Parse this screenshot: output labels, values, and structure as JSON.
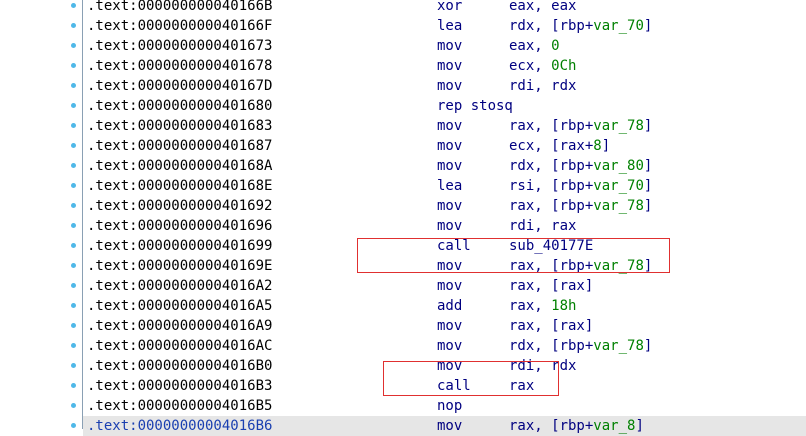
{
  "colors": {
    "background": "#ffffff",
    "address": "#000000",
    "instruction": "#000080",
    "variable": "#008000",
    "gutter_dot": "#4fb8e8",
    "annotation_box": "#e03030",
    "current_row": "#e6e6e6"
  },
  "listing": [
    {
      "addr": ".text:000000000040166B",
      "mnem": "xor",
      "ops": [
        {
          "t": "eax, eax",
          "c": "k"
        }
      ]
    },
    {
      "addr": ".text:000000000040166F",
      "mnem": "lea",
      "ops": [
        {
          "t": "rdx, [rbp+",
          "c": "k"
        },
        {
          "t": "var_70",
          "c": "v"
        },
        {
          "t": "]",
          "c": "k"
        }
      ]
    },
    {
      "addr": ".text:0000000000401673",
      "mnem": "mov",
      "ops": [
        {
          "t": "eax, ",
          "c": "k"
        },
        {
          "t": "0",
          "c": "v"
        }
      ]
    },
    {
      "addr": ".text:0000000000401678",
      "mnem": "mov",
      "ops": [
        {
          "t": "ecx, ",
          "c": "k"
        },
        {
          "t": "0Ch",
          "c": "v"
        }
      ]
    },
    {
      "addr": ".text:000000000040167D",
      "mnem": "mov",
      "ops": [
        {
          "t": "rdi, rdx",
          "c": "k"
        }
      ]
    },
    {
      "addr": ".text:0000000000401680",
      "mnem": "rep stosq",
      "ops": []
    },
    {
      "addr": ".text:0000000000401683",
      "mnem": "mov",
      "ops": [
        {
          "t": "rax, [rbp+",
          "c": "k"
        },
        {
          "t": "var_78",
          "c": "v"
        },
        {
          "t": "]",
          "c": "k"
        }
      ]
    },
    {
      "addr": ".text:0000000000401687",
      "mnem": "mov",
      "ops": [
        {
          "t": "ecx, [rax+",
          "c": "k"
        },
        {
          "t": "8",
          "c": "v"
        },
        {
          "t": "]",
          "c": "k"
        }
      ]
    },
    {
      "addr": ".text:000000000040168A",
      "mnem": "mov",
      "ops": [
        {
          "t": "rdx, [rbp+",
          "c": "k"
        },
        {
          "t": "var_80",
          "c": "v"
        },
        {
          "t": "]",
          "c": "k"
        }
      ]
    },
    {
      "addr": ".text:000000000040168E",
      "mnem": "lea",
      "ops": [
        {
          "t": "rsi, [rbp+",
          "c": "k"
        },
        {
          "t": "var_70",
          "c": "v"
        },
        {
          "t": "]",
          "c": "k"
        }
      ]
    },
    {
      "addr": ".text:0000000000401692",
      "mnem": "mov",
      "ops": [
        {
          "t": "rax, [rbp+",
          "c": "k"
        },
        {
          "t": "var_78",
          "c": "v"
        },
        {
          "t": "]",
          "c": "k"
        }
      ]
    },
    {
      "addr": ".text:0000000000401696",
      "mnem": "mov",
      "ops": [
        {
          "t": "rdi, rax",
          "c": "k"
        }
      ]
    },
    {
      "addr": ".text:0000000000401699",
      "mnem": "call",
      "ops": [
        {
          "t": "sub_40177E",
          "c": "k"
        }
      ]
    },
    {
      "addr": ".text:000000000040169E",
      "mnem": "mov",
      "ops": [
        {
          "t": "rax, [rbp+",
          "c": "k"
        },
        {
          "t": "var_78",
          "c": "v"
        },
        {
          "t": "]",
          "c": "k"
        }
      ]
    },
    {
      "addr": ".text:00000000004016A2",
      "mnem": "mov",
      "ops": [
        {
          "t": "rax, [rax]",
          "c": "k"
        }
      ]
    },
    {
      "addr": ".text:00000000004016A5",
      "mnem": "add",
      "ops": [
        {
          "t": "rax, ",
          "c": "k"
        },
        {
          "t": "18h",
          "c": "v"
        }
      ]
    },
    {
      "addr": ".text:00000000004016A9",
      "mnem": "mov",
      "ops": [
        {
          "t": "rax, [rax]",
          "c": "k"
        }
      ]
    },
    {
      "addr": ".text:00000000004016AC",
      "mnem": "mov",
      "ops": [
        {
          "t": "rdx, [rbp+",
          "c": "k"
        },
        {
          "t": "var_78",
          "c": "v"
        },
        {
          "t": "]",
          "c": "k"
        }
      ]
    },
    {
      "addr": ".text:00000000004016B0",
      "mnem": "mov",
      "ops": [
        {
          "t": "rdi, rdx",
          "c": "k"
        }
      ]
    },
    {
      "addr": ".text:00000000004016B3",
      "mnem": "call",
      "ops": [
        {
          "t": "rax",
          "c": "k"
        }
      ]
    },
    {
      "addr": ".text:00000000004016B5",
      "mnem": "nop",
      "ops": []
    },
    {
      "addr": ".text:00000000004016B6",
      "mnem": "mov",
      "ops": [
        {
          "t": "rax, [rbp+",
          "c": "k"
        },
        {
          "t": "var_8",
          "c": "v"
        },
        {
          "t": "]",
          "c": "k"
        }
      ],
      "current": true
    }
  ]
}
